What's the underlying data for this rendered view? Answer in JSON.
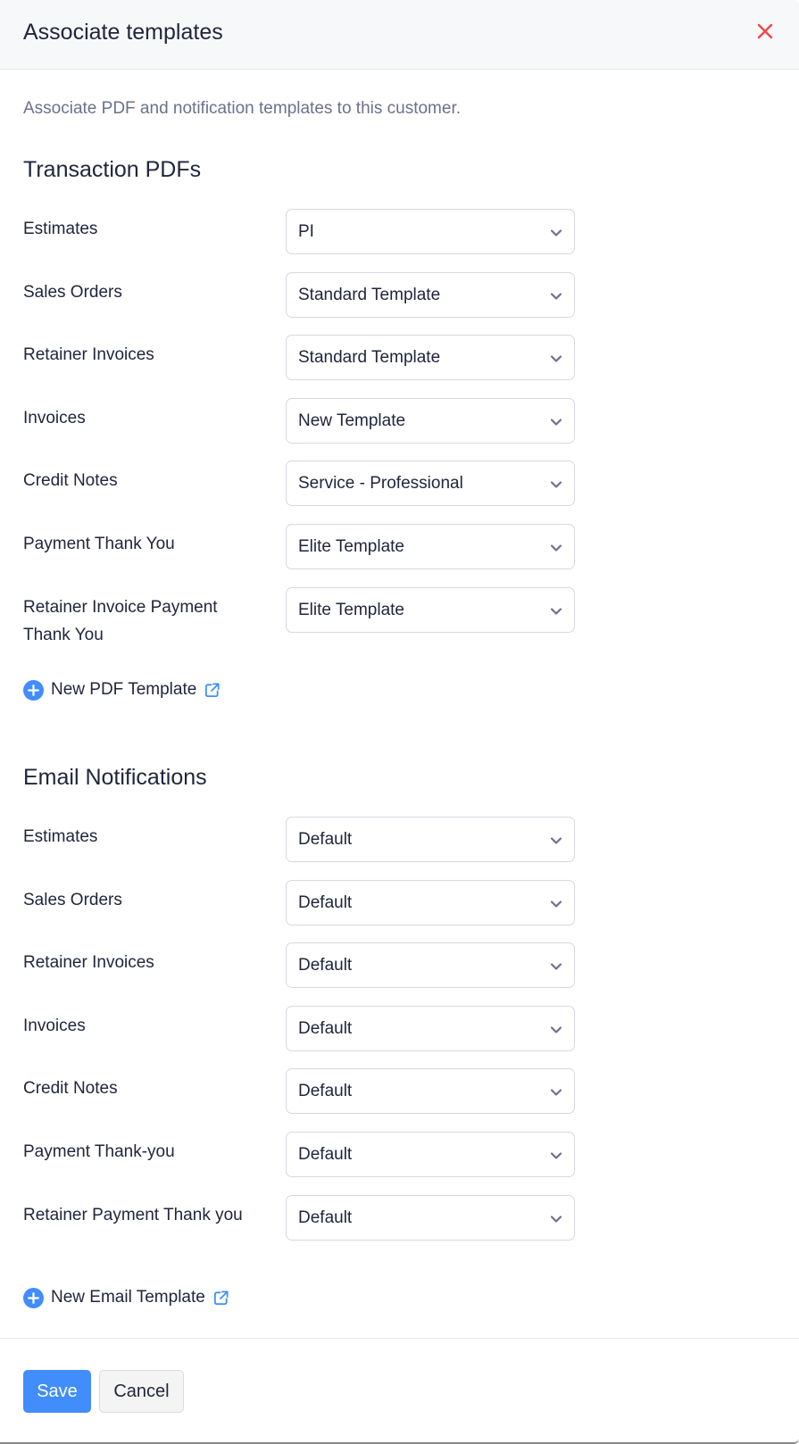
{
  "dialog": {
    "title": "Associate templates",
    "close_label": "Close",
    "description": "Associate PDF and notification templates to this customer."
  },
  "colors": {
    "primary": "#408dfb",
    "close": "#f04747",
    "text": "#21263c",
    "muted": "#6c718a"
  },
  "transaction_pdfs": {
    "title": "Transaction PDFs",
    "rows": [
      {
        "label": "Estimates",
        "value": "PI"
      },
      {
        "label": "Sales Orders",
        "value": "Standard Template"
      },
      {
        "label": "Retainer Invoices",
        "value": "Standard Template"
      },
      {
        "label": "Invoices",
        "value": "New Template"
      },
      {
        "label": "Credit Notes",
        "value": "Service - Professional"
      },
      {
        "label": "Payment Thank You",
        "value": "Elite Template"
      },
      {
        "label": "Retainer Invoice Payment Thank You",
        "value": "Elite Template"
      }
    ],
    "add_link": "New PDF Template"
  },
  "email_notifications": {
    "title": "Email Notifications",
    "rows": [
      {
        "label": "Estimates",
        "value": "Default"
      },
      {
        "label": "Sales Orders",
        "value": "Default"
      },
      {
        "label": "Retainer Invoices",
        "value": "Default"
      },
      {
        "label": "Invoices",
        "value": "Default"
      },
      {
        "label": "Credit Notes",
        "value": "Default"
      },
      {
        "label": "Payment Thank-you",
        "value": "Default"
      },
      {
        "label": "Retainer Payment Thank you",
        "value": "Default"
      }
    ],
    "add_link": "New Email Template"
  },
  "footer": {
    "save_label": "Save",
    "cancel_label": "Cancel"
  }
}
